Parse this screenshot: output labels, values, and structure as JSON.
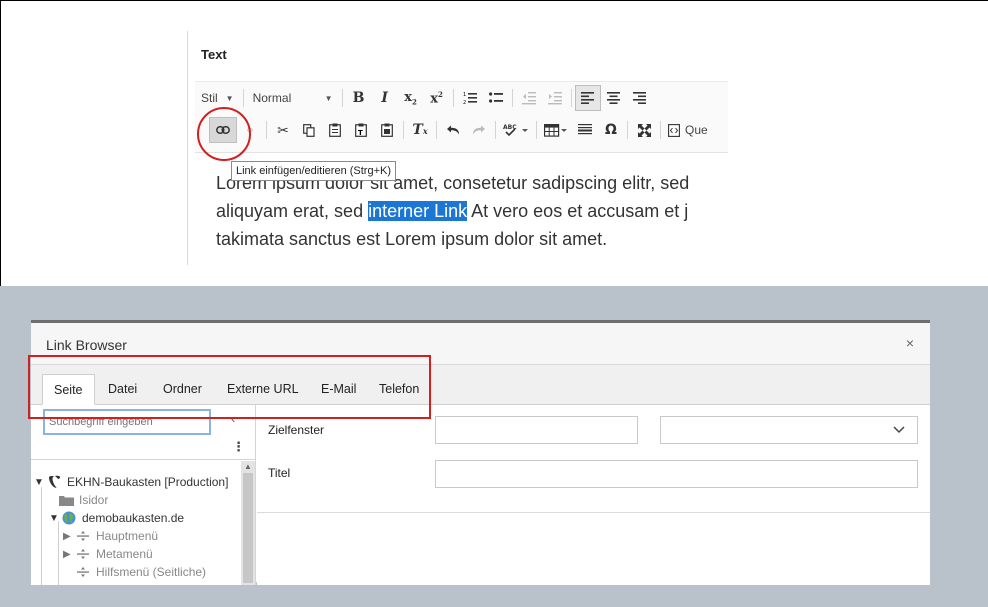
{
  "editor": {
    "field_label": "Text",
    "toolbar": {
      "style_dropdown": "Stil",
      "format_dropdown": "Normal",
      "source_label": "Que"
    },
    "tooltip": "Link einfügen/editieren (Strg+K)",
    "content": {
      "line1": "Lorem ipsum dolor sit amet, consetetur sadipscing elitr, sed",
      "line2_before": "aliquyam erat, sed ",
      "line2_link": "interner Link",
      "line2_after": " At vero eos et accusam et j",
      "line3": "takimata sanctus est Lorem ipsum dolor sit amet."
    }
  },
  "link_browser": {
    "title": "Link Browser",
    "close_symbol": "×",
    "tabs": [
      {
        "label": "Seite",
        "active": true
      },
      {
        "label": "Datei"
      },
      {
        "label": "Ordner"
      },
      {
        "label": "Externe URL"
      },
      {
        "label": "E-Mail"
      },
      {
        "label": "Telefon"
      }
    ],
    "search_placeholder": "Suchbegriff eingeben",
    "tree": [
      {
        "label": "EKHN-Baukasten [Production]"
      },
      {
        "label": "Isidor"
      },
      {
        "label": "demobaukasten.de"
      },
      {
        "label": "Hauptmenü"
      },
      {
        "label": "Metamenü"
      },
      {
        "label": "Hilfsmenü (Seitliche)"
      }
    ],
    "form": {
      "target_label": "Zielfenster",
      "title_label": "Titel"
    }
  },
  "colors": {
    "highlight": "#1b77d3",
    "annotation_red": "#d21f1f",
    "backdrop": "#b9c1cb"
  }
}
